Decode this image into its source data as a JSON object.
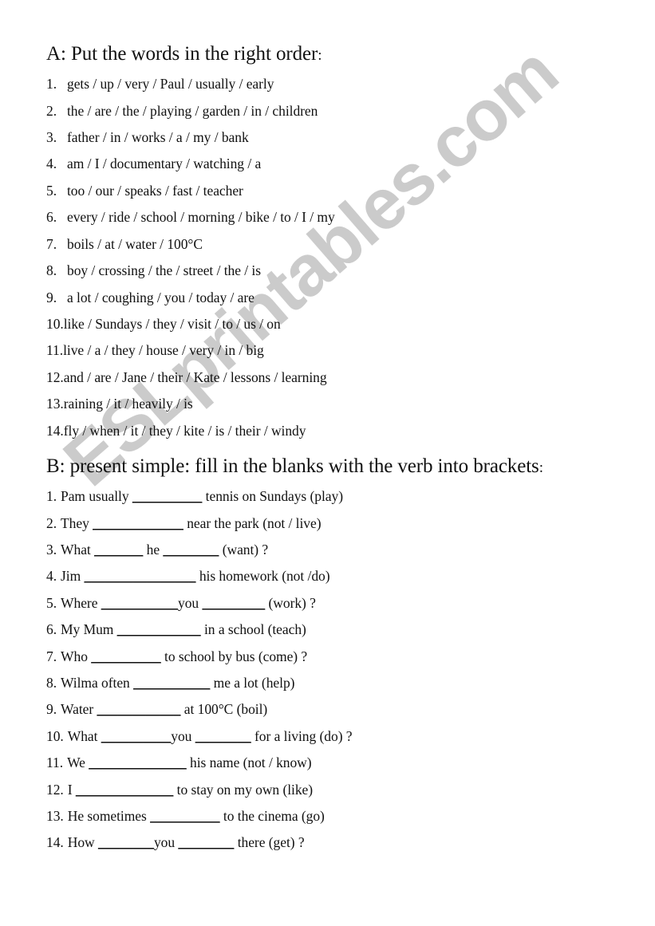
{
  "document": {
    "watermark": "ESLprintables.com",
    "watermark_color": "#cbcbcb",
    "text_color": "#111111",
    "background_color": "#ffffff"
  },
  "section_a": {
    "heading": "A: Put the words in the right order",
    "heading_colon": ":",
    "items": [
      {
        "number": "1.",
        "text": "gets / up / very / Paul / usually / early",
        "tight": false
      },
      {
        "number": "2.",
        "text": "the / are / the / playing / garden / in / children",
        "tight": false
      },
      {
        "number": "3.",
        "text": "father / in / works / a / my / bank",
        "tight": false
      },
      {
        "number": "4.",
        "text": "am / I /  documentary / watching / a",
        "tight": false
      },
      {
        "number": "5.",
        "text": "too / our / speaks / fast / teacher",
        "tight": false
      },
      {
        "number": "6.",
        "text": "every / ride / school / morning / bike / to / I / my",
        "tight": false
      },
      {
        "number": "7.",
        "text": "boils / at / water / 100°C",
        "tight": false
      },
      {
        "number": "8.",
        "text": "boy / crossing / the / street / the / is",
        "tight": false
      },
      {
        "number": "9.",
        "text": "a lot / coughing / you / today / are",
        "tight": false
      },
      {
        "number": "10.",
        "text": "like / Sundays / they / visit / to / us / on",
        "tight": true
      },
      {
        "number": "11.",
        "text": "live / a / they / house / very / in / big",
        "tight": true
      },
      {
        "number": "12.",
        "text": "and / are / Jane / their / Kate / lessons / learning",
        "tight": true
      },
      {
        "number": "13.",
        "text": "raining / it / heavily / is",
        "tight": true
      },
      {
        "number": "14.",
        "text": "fly / when / it / they / kite / is / their / windy",
        "tight": true
      }
    ]
  },
  "section_b": {
    "heading": "B: present simple: fill in the blanks with the verb into brackets",
    "heading_colon": ":",
    "items": [
      {
        "number": "1.",
        "before": "Pam usually ",
        "blank1": "__________",
        "middle": "",
        "blank2": "",
        "after": " tennis on Sundays (play)"
      },
      {
        "number": "2.",
        "before": "They ",
        "blank1": "_____________",
        "middle": "",
        "blank2": "",
        "after": " near the park (not / live)"
      },
      {
        "number": "3.",
        "before": "What ",
        "blank1": "_______",
        "middle": " he ",
        "blank2": "________",
        "after": " (want) ?"
      },
      {
        "number": "4.",
        "before": "Jim ",
        "blank1": "________________",
        "middle": "",
        "blank2": "",
        "after": " his homework (not /do)"
      },
      {
        "number": "5.",
        "before": "Where ",
        "blank1": "___________",
        "middle": "you ",
        "blank2": "_________",
        "after": " (work) ?"
      },
      {
        "number": "6.",
        "before": "My Mum ",
        "blank1": "____________",
        "middle": "",
        "blank2": "",
        "after": " in a school (teach)"
      },
      {
        "number": "7.",
        "before": "Who ",
        "blank1": "__________",
        "middle": "",
        "blank2": "",
        "after": " to school by bus (come) ?"
      },
      {
        "number": "8.",
        "before": "Wilma often ",
        "blank1": "___________",
        "middle": "",
        "blank2": "",
        "after": " me a lot (help)"
      },
      {
        "number": "9.",
        "before": "Water ",
        "blank1": "____________",
        "middle": "",
        "blank2": "",
        "after": " at 100°C (boil)"
      },
      {
        "number": "10.",
        "before": "What ",
        "blank1": "__________",
        "middle": "you ",
        "blank2": "________",
        "after": " for a living (do) ?"
      },
      {
        "number": "11.",
        "before": "We ",
        "blank1": "______________",
        "middle": "",
        "blank2": "",
        "after": " his name (not / know)"
      },
      {
        "number": "12.",
        "before": "I ",
        "blank1": "______________",
        "middle": "",
        "blank2": "",
        "after": " to stay on my own (like)"
      },
      {
        "number": "13.",
        "before": "He sometimes ",
        "blank1": "__________",
        "middle": "",
        "blank2": "",
        "after": " to the cinema (go)"
      },
      {
        "number": "14.",
        "before": "How ",
        "blank1": "________",
        "middle": "you ",
        "blank2": "________",
        "after": " there (get) ?"
      }
    ]
  }
}
